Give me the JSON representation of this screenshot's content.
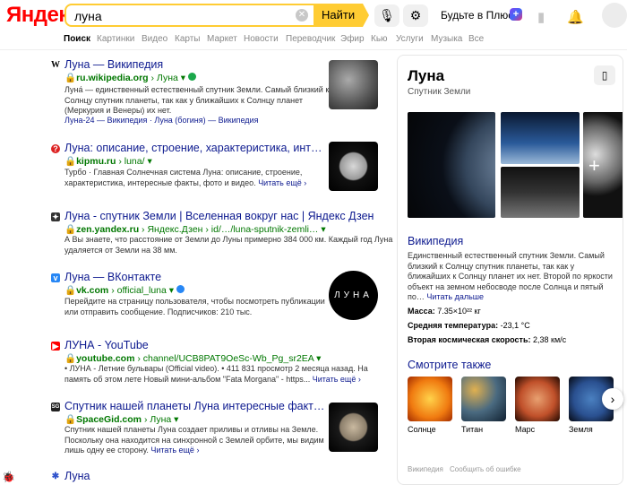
{
  "header": {
    "logo": "Яндекс",
    "query": "луна",
    "search_label": "Найти",
    "plus_label": "Будьте в Плюсе"
  },
  "nav": [
    "Поиск",
    "Картинки",
    "Видео",
    "Карты",
    "Маркет",
    "Новости",
    "Переводчик",
    "Эфир",
    "Кью",
    "Услуги",
    "Музыка",
    "Все"
  ],
  "results": [
    {
      "title": "Луна — Википедия",
      "url_domain": "ru.wikipedia.org",
      "url_path": "› Луна",
      "snippet": [
        "Луна́ — единственный естественный спутник Земли. Самый близкий к",
        "Солнцу спутник планеты, так как у ближайших к Солнцу планет",
        "(Меркурия и Венеры) их нет."
      ],
      "sublinks": "Луна-24 — Википедия · Луна (богиня) — Википедия"
    },
    {
      "title": "Луна: описание, строение, характеристика, инт…",
      "url_domain": "kipmu.ru",
      "url_path": "› luna/",
      "snippet": [
        "Турбо · Главная Солнечная система Луна: описание, строение,",
        "характеристика, интересные факты, фото и видео."
      ],
      "more": "Читать ещё ›"
    },
    {
      "title": "Луна - спутник Земли | Вселенная вокруг нас | Яндекс Дзен",
      "url_domain": "zen.yandex.ru",
      "url_path": "› Яндекс.Дзен › id/…/luna-sputnik-zemli…",
      "snippet": [
        "А Вы знаете, что расстояние от Земли до Луны примерно 384 000 км. Каждый год Луна",
        "удаляется от Земли на 38 мм."
      ]
    },
    {
      "title": "Луна — ВКонтакте",
      "url_domain": "vk.com",
      "url_path": "› official_luna",
      "snippet": [
        "Перейдите на страницу пользователя, чтобы посмотреть публикации",
        "или отправить сообщение.   Подписчиков: 210 тыс."
      ],
      "thumb_text": "ЛУНА"
    },
    {
      "title": "ЛУНА - YouTube",
      "url_domain": "youtube.com",
      "url_path": "› channel/UCB8PAT9OeSc-Wb_Pg_sr2EA",
      "snippet": [
        "• ЛУНА - Летние бульвары (Official video). • 411 831 просмотр 2 месяца назад. На",
        "память об этом лете Новый мини-альбом \"Fata Morgana\" - https..."
      ],
      "more": "Читать ещё ›"
    },
    {
      "title": "Спутник нашей планеты Луна интересные факт…",
      "url_domain": "SpaceGid.com",
      "url_path": "› Луна",
      "snippet": [
        "Спутник нашей планеты Луна создает приливы и отливы на Земле.",
        "Поскольку она находится на синхронной с Землей орбите, мы видим",
        "лишь одну ее сторону."
      ],
      "more": "Читать ещё ›"
    },
    {
      "title": "Луна"
    }
  ],
  "panel": {
    "title": "Луна",
    "subtitle": "Спутник Земли",
    "wiki_title": "Википедия",
    "wiki_text": "Единственный естественный спутник Земли. Самый близкий к Солнцу спутник планеты, так как у ближайших к Солнцу планет их нет. Второй по яркости объект на земном небосводе после Солнца и пятый по…",
    "wiki_more": "Читать дальше",
    "facts": [
      {
        "label": "Масса:",
        "value": " 7.35×10²² кг"
      },
      {
        "label": "Средняя температура:",
        "value": " -23,1 °C"
      },
      {
        "label": "Вторая космическая скорость:",
        "value": " 2,38 км/с"
      }
    ],
    "see_also_title": "Смотрите также",
    "see_also": [
      "Солнце",
      "Титан",
      "Марс",
      "Земля"
    ],
    "footer": [
      "Википедия",
      "Сообщить об ошибке"
    ]
  }
}
